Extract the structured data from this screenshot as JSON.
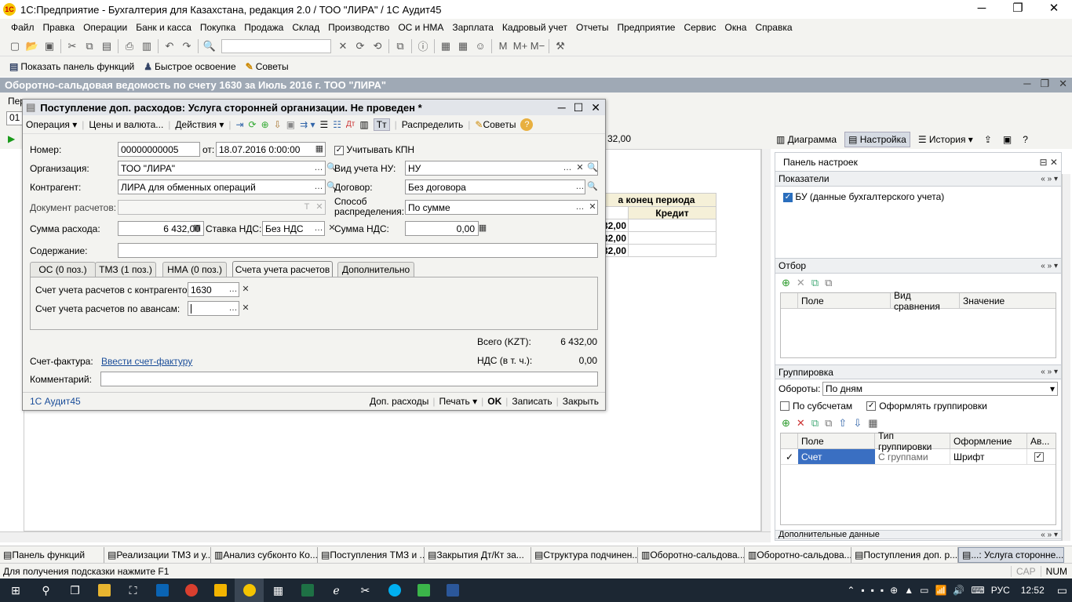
{
  "window": {
    "title": "1С:Предприятие - Бухгалтерия для Казахстана, редакция 2.0 / ТОО \"ЛИРА\" / 1С Аудит45"
  },
  "menu": [
    "Файл",
    "Правка",
    "Операции",
    "Банк и касса",
    "Покупка",
    "Продажа",
    "Склад",
    "Производство",
    "ОС и НМА",
    "Зарплата",
    "Кадровый учет",
    "Отчеты",
    "Предприятие",
    "Сервис",
    "Окна",
    "Справка"
  ],
  "panelbar": {
    "functions": "Показать панель функций",
    "quick": "Быстрое освоение",
    "tips": "Советы"
  },
  "bg": {
    "title": "Оборотно-сальдовая ведомость по счету 1630 за Июль 2016 г. ТОО \"ЛИРА\"",
    "left_label1": "Пер",
    "left_label2": "01",
    "toolbar": {
      "diagram": "Диаграмма",
      "settings": "Настройка",
      "history": "История",
      "amount": "32,00"
    },
    "report": {
      "header": "а конец периода",
      "credit": "Кредит",
      "rows": [
        "32,00",
        "32,00",
        "32,00"
      ]
    },
    "settings_panel": {
      "title": "Панель настроек",
      "indicators": "Показатели",
      "indicator_item": "БУ (данные бухгалтерского учета)",
      "filter": "Отбор",
      "filter_cols": [
        "Поле",
        "Вид сравнения",
        "Значение"
      ],
      "grouping": "Группировка",
      "turnover_label": "Обороты:",
      "turnover_value": "По дням",
      "by_subaccounts": "По субсчетам",
      "format_groups": "Оформлять группировки",
      "grp_cols": [
        "Поле",
        "Тип группировки",
        "Оформление",
        "Ав..."
      ],
      "grp_row": {
        "field": "Счет",
        "type": "С группами",
        "format": "Шрифт"
      },
      "additional": "Дополнительные данные"
    }
  },
  "dialog": {
    "title": "Поступление доп. расходов: Услуга сторонней организации. Не проведен *",
    "toolbar": {
      "operation": "Операция",
      "prices": "Цены и валюта...",
      "actions": "Действия",
      "distribute": "Распределить",
      "tips": "Советы"
    },
    "number_label": "Номер:",
    "number": "00000000005",
    "date_label": "от:",
    "date": "18.07.2016  0:00:00",
    "kpn_label": "Учитывать КПН",
    "org_label": "Организация:",
    "org": "ТОО \"ЛИРА\"",
    "nu_label": "Вид учета НУ:",
    "nu": "НУ",
    "contractor_label": "Контрагент:",
    "contractor": "ЛИРА для обменных операций",
    "contract_label": "Договор:",
    "contract": "Без договора",
    "settlement_label": "Документ расчетов:",
    "method_label1": "Способ",
    "method_label2": "распределения:",
    "method": "По сумме",
    "sum_label": "Сумма расхода:",
    "sum": "6 432,00",
    "vat_rate_label": "Ставка НДС:",
    "vat_rate": "Без НДС",
    "vat_sum_label": "Сумма НДС:",
    "vat_sum": "0,00",
    "content_label": "Содержание:",
    "tabs": [
      "ОС (0 поз.)",
      "ТМЗ (1 поз.)",
      "НМА (0 поз.)",
      "Счета учета расчетов",
      "Дополнительно"
    ],
    "acc_contractor_label": "Счет учета расчетов с контрагентом:",
    "acc_contractor": "1630",
    "acc_advance_label": "Счет учета расчетов по авансам:",
    "total_label": "Всего (KZT):",
    "total": "6 432,00",
    "vat_incl_label": "НДС (в т. ч.):",
    "vat_incl": "0,00",
    "invoice_label": "Счет-фактура:",
    "invoice_link": "Ввести счет-фактуру",
    "comment_label": "Комментарий:",
    "footer": {
      "user": "1С Аудит45",
      "extra": "Доп. расходы",
      "print": "Печать",
      "ok": "OK",
      "save": "Записать",
      "close": "Закрыть"
    }
  },
  "window_tabs": [
    "Панель функций",
    "Реализации ТМЗ и у...",
    "Анализ субконто Ко...",
    "Поступления ТМЗ и ...",
    "Закрытия Дт/Кт за...",
    "Структура подчинен...",
    "Оборотно-сальдова...",
    "Оборотно-сальдова...",
    "Поступления доп. р...",
    "...: Услуга сторонне..."
  ],
  "status": {
    "hint": "Для получения подсказки нажмите F1",
    "cap": "CAP",
    "num": "NUM"
  },
  "tray": {
    "lang": "РУС",
    "time": "12:52"
  }
}
